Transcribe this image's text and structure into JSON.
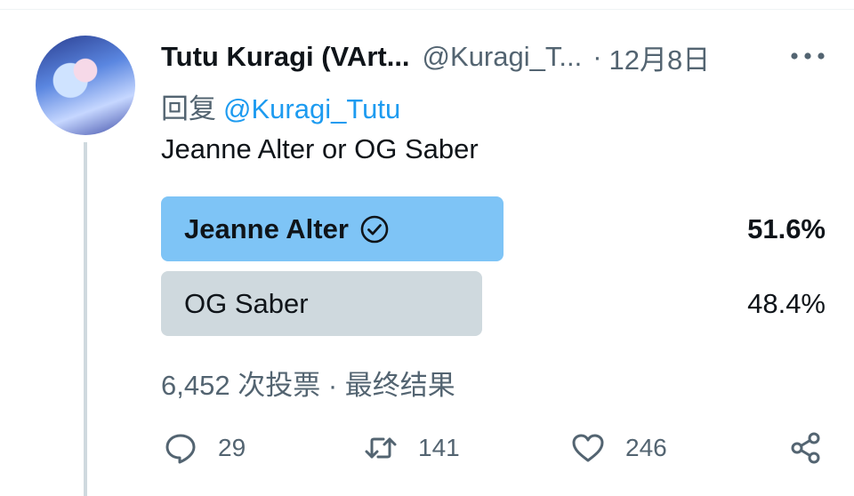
{
  "tweet": {
    "display_name": "Tutu Kuragi (VArt...",
    "handle": "@Kuragi_T...",
    "separator": "·",
    "date": "12月8日",
    "reply_prefix": "回复",
    "reply_to": "@Kuragi_Tutu",
    "text": "Jeanne Alter or OG Saber"
  },
  "poll": {
    "options": [
      {
        "label": "Jeanne Alter",
        "percent": "51.6%",
        "winner": true
      },
      {
        "label": "OG Saber",
        "percent": "48.4%",
        "winner": false
      }
    ],
    "votes": "6,452 次投票",
    "separator": "·",
    "status": "最终结果"
  },
  "actions": {
    "reply_count": "29",
    "retweet_count": "141",
    "like_count": "246"
  },
  "colors": {
    "accent": "#1d9bf0",
    "winner_bar": "#7ec4f6",
    "other_bar": "#cfd9de",
    "secondary_text": "#536471"
  },
  "icons": [
    "more-icon",
    "check-circle-icon",
    "reply-icon",
    "retweet-icon",
    "like-icon",
    "share-icon"
  ]
}
